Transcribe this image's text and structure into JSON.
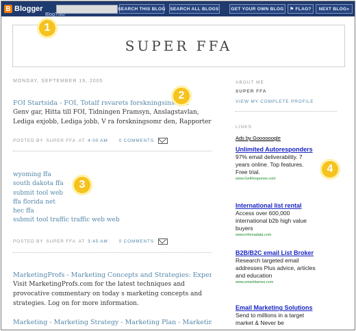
{
  "navbar": {
    "logo_letter": "B",
    "logo_text": "Blogger",
    "logo_sub": "BlogThis!",
    "search_this": "SEARCH THIS BLOG",
    "search_all": "SEARCH ALL BLOGS",
    "get_blog": "GET YOUR OWN BLOG",
    "flag": "⚑ FLAG?",
    "next_blog": "NEXT BLOG»",
    "bg_color": "#1f3a6e"
  },
  "header": {
    "title": "SUPER FFA"
  },
  "main": {
    "date": "MONDAY, SEPTEMBER 19, 2005",
    "post1": {
      "title": "FOI Startsida - FOI, Totalf rsvarets forskningsinstitut",
      "body": "Genv gar, Hitta till FOI, Tidningen Framsyn, Anslagstavlan, Lediga exjobb, Lediga jobb, V ra forskningsomr den, Rapporter",
      "footer_prefix": "POSTED BY",
      "author": "SUPER FFA",
      "at": "AT",
      "time": "4:00 AM",
      "comments": "0 COMMENTS"
    },
    "post2": {
      "links": [
        "wyoming ffa",
        "south dakota ffa",
        "submit tool web",
        "ffa florida net",
        "hec ffa",
        "submit tool traffic traffic web web"
      ],
      "footer_prefix": "POSTED BY",
      "author": "SUPER FFA",
      "at": "AT",
      "time": "3:45 AM",
      "comments": "0 COMMENTS"
    },
    "post3": {
      "title": "MarketingProfs - Marketing Concepts and Strategies: Expert",
      "body": "Visit MarketingProfs.com for the latest techniques and provocative commentary on today s marketing concepts and strategies. Log on for more information."
    },
    "post4": {
      "title": "Marketing - Marketing Strategy - Marketing Plan - Marketing"
    }
  },
  "sidebar": {
    "about_heading": "ABOUT ME",
    "name": "SUPER FFA",
    "profile_link": "VIEW MY COMPLETE PROFILE",
    "links_heading": "LINKS",
    "ads_by": "Ads by Goooooogle",
    "ads": [
      {
        "title": "Unlimited Autoresponders",
        "text": "97% email deliverability. 7 years online. Top features. Free trial.",
        "url": "www.GetResponse.com"
      },
      {
        "title": "International list rental",
        "text": "Access over 600,000 international b2b high value buyers",
        "url": "www.infomadata.com"
      },
      {
        "title": "B2B/B2C email List Broker",
        "text": "Research targeted email addresses Plus advice, articles and education",
        "url": "www.smartdames.com"
      },
      {
        "title": "Email Marketing Solutions",
        "text": "Send to millions in a target market & Never be",
        "url": ""
      }
    ]
  },
  "badges": [
    "1",
    "2",
    "3",
    "4"
  ]
}
